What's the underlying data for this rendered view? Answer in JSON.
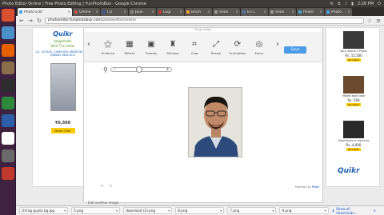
{
  "window": {
    "title": "Photo Editor Online | Free Photo Editing | FunPhotoBox - Google Chrome"
  },
  "system": {
    "tray_icons": [
      "mail-icon",
      "network-icon",
      "volume-icon",
      "battery-icon"
    ],
    "clock": "2:26 PM"
  },
  "launcher": [
    {
      "name": "ubuntu-dash",
      "color": "#d9512c"
    },
    {
      "name": "chromium",
      "color": "#4a90c8"
    },
    {
      "name": "firefox",
      "color": "#e66000"
    },
    {
      "name": "files",
      "color": "#8a6d4a"
    },
    {
      "name": "terminal",
      "color": "#2d2d2d"
    },
    {
      "name": "calc",
      "color": "#2d8a3a"
    },
    {
      "name": "writer",
      "color": "#2d5fa8"
    },
    {
      "name": "amazon",
      "color": "#ffffff"
    },
    {
      "name": "settings",
      "color": "#6a6a6a"
    },
    {
      "name": "updates",
      "color": "#c0392b"
    }
  ],
  "tabs": [
    {
      "label": "Photo Edit",
      "active": true,
      "color": "#4aa3df"
    },
    {
      "label": "Online",
      "active": false,
      "color": "#d9534f"
    },
    {
      "label": "(1)",
      "active": false,
      "color": "#3b5998"
    },
    {
      "label": "Jaun",
      "active": false,
      "color": "#888888"
    },
    {
      "label": "Logi",
      "active": false,
      "color": "#cc3333"
    },
    {
      "label": "Brom",
      "active": false,
      "color": "#f0a020"
    },
    {
      "label": "Shan",
      "active": false,
      "color": "#999999"
    },
    {
      "label": "En C",
      "active": false,
      "color": "#5577aa"
    },
    {
      "label": "Shan",
      "active": false,
      "color": "#999999"
    },
    {
      "label": "Photo",
      "active": false,
      "color": "#4aa3df"
    },
    {
      "label": "Photo",
      "active": false,
      "color": "#4aa3df"
    }
  ],
  "address": {
    "domain": "photoeditor.funphotobox.com",
    "path": "/photoeditor/online"
  },
  "editor": {
    "title": "Photo Editor",
    "tools": [
      {
        "label": "Enhance",
        "icon": "magic-wand-icon"
      },
      {
        "label": "Effects",
        "icon": "effects-icon"
      },
      {
        "label": "Frames",
        "icon": "frame-icon"
      },
      {
        "label": "Stickers",
        "icon": "hat-icon"
      },
      {
        "label": "Crop",
        "icon": "crop-icon"
      },
      {
        "label": "Resize",
        "icon": "resize-icon"
      },
      {
        "label": "Orientation",
        "icon": "rotate-icon"
      },
      {
        "label": "Focus",
        "icon": "focus-icon"
      }
    ],
    "save_label": "Save",
    "zoom": {
      "level": 0.45
    },
    "powered_by": "Powered by",
    "powered_brand": "Pixlr",
    "bottom_tab": "Edit another image"
  },
  "ad_left": {
    "brand": "Quikr",
    "tagline1": "Negotiate",
    "tagline2": "With The Seller",
    "headline": "LG, VOLTAS, SAMSUNG WINDOW AC'S",
    "subline": "BRAND NEW ACS",
    "price": "₹6,500",
    "cta": "Make Offer"
  },
  "ad_right": {
    "products": [
      {
        "name": "Sony Xperia Z Phone",
        "price": "Rs. 15,500",
        "buy": "Buy Now"
      },
      {
        "name": "Mobile back case",
        "price": "Rs. 540",
        "buy": "Buy Now"
      },
      {
        "name": "Good phone in low price",
        "price": "Rs. 4,000",
        "buy": "Buy Now"
      }
    ],
    "brand": "Quikr"
  },
  "downloads": [
    {
      "name": "chirag gupta bg.jpg"
    },
    {
      "name": "5.png"
    },
    {
      "name": "download (2).png"
    },
    {
      "name": "8.png"
    },
    {
      "name": "7.png"
    },
    {
      "name": "9.png"
    }
  ],
  "show_all": "Show all downloads..."
}
